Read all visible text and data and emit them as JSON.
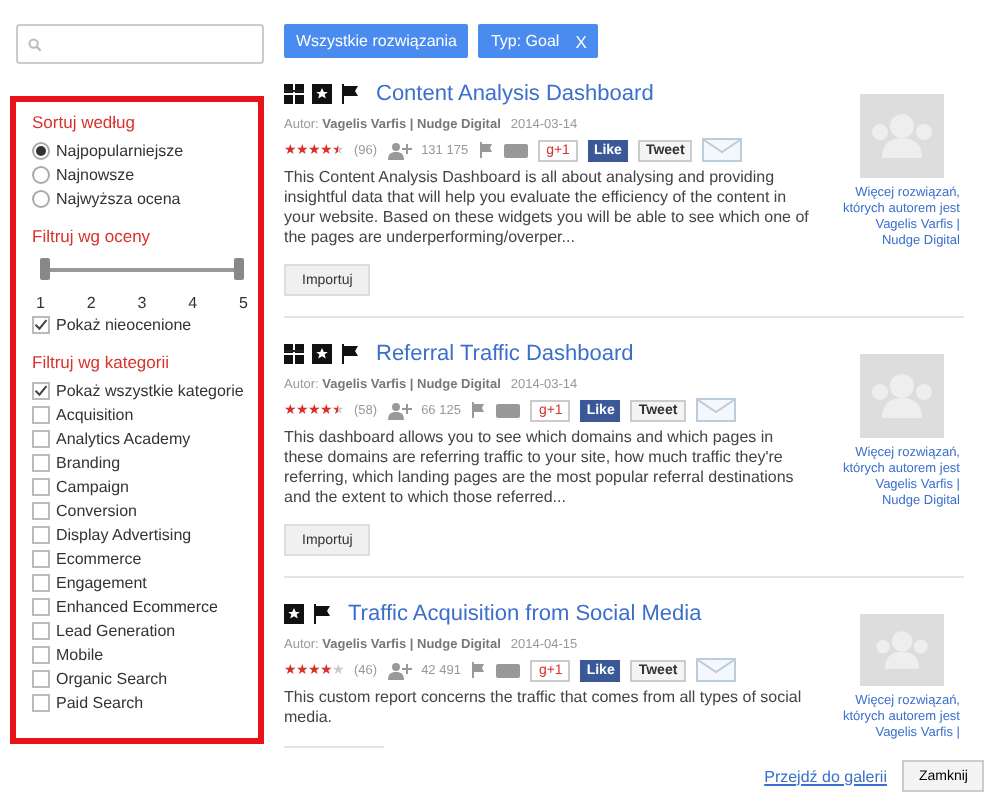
{
  "filters": [
    {
      "label": "Wszystkie rozwiązania"
    },
    {
      "label": "Typ: Goal",
      "remove": "X"
    }
  ],
  "sidebar": {
    "sort": {
      "title": "Sortuj według",
      "options": [
        {
          "label": "Najpopularniejsze",
          "selected": true
        },
        {
          "label": "Najnowsze",
          "selected": false
        },
        {
          "label": "Najwyższa ocena",
          "selected": false
        }
      ]
    },
    "rating": {
      "title": "Filtruj wg oceny",
      "handles": [
        {
          "level": 0
        },
        {
          "level": 1
        }
      ],
      "ticks": [
        "1",
        "2",
        "3",
        "4",
        "5"
      ],
      "unrated": {
        "label": "Pokaż nieocenione",
        "checked": true
      }
    },
    "categories": {
      "title": "Filtruj wg kategorii",
      "items": [
        {
          "label": "Pokaż wszystkie kategorie",
          "checked": true
        },
        {
          "label": "Acquisition",
          "checked": false
        },
        {
          "label": "Analytics Academy",
          "checked": false
        },
        {
          "label": "Branding",
          "checked": false
        },
        {
          "label": "Campaign",
          "checked": false
        },
        {
          "label": "Conversion",
          "checked": false
        },
        {
          "label": "Display Advertising",
          "checked": false
        },
        {
          "label": "Ecommerce",
          "checked": false
        },
        {
          "label": "Engagement",
          "checked": false
        },
        {
          "label": "Enhanced Ecommerce",
          "checked": false
        },
        {
          "label": "Lead Generation",
          "checked": false
        },
        {
          "label": "Mobile",
          "checked": false
        },
        {
          "label": "Organic Search",
          "checked": false
        },
        {
          "label": "Paid Search",
          "checked": false
        }
      ]
    }
  },
  "results": [
    {
      "icons": [
        {
          "kind": "dashboard"
        },
        {
          "kind": "segment"
        },
        {
          "kind": "goal"
        }
      ],
      "gplus": "g+1",
      "like": "Like",
      "tweet": "Tweet",
      "title": "Content Analysis Dashboard",
      "author_label": "Autor:",
      "author": "Vagelis Varfis | Nudge Digital",
      "date": "2014-03-14",
      "stars": 4.5,
      "reviews": "(96)",
      "imports": "131 175",
      "description": "This Content Analysis Dashboard is all about analysing and providing insightful data that will help you evaluate the efficiency of the content in your website. Based on these widgets you will be able to see which one of the pages are underperforming/overper...",
      "import_button": "Importuj",
      "more_link": [
        "Więcej rozwiązań,",
        "których autorem jest",
        "Vagelis Varfis |",
        "Nudge Digital"
      ]
    },
    {
      "icons": [
        {
          "kind": "dashboard"
        },
        {
          "kind": "segment"
        },
        {
          "kind": "goal"
        }
      ],
      "gplus": "g+1",
      "like": "Like",
      "tweet": "Tweet",
      "title": "Referral Traffic Dashboard",
      "author_label": "Autor:",
      "author": "Vagelis Varfis | Nudge Digital",
      "date": "2014-03-14",
      "stars": 4.5,
      "reviews": "(58)",
      "imports": "66 125",
      "description": "This dashboard allows you to see which domains and which pages in these domains are referring traffic to your site, how much traffic they're referring, which landing pages are the most popular referral destinations and the extent to which those referred...",
      "import_button": "Importuj",
      "more_link": [
        "Więcej rozwiązań,",
        "których autorem jest",
        "Vagelis Varfis |",
        "Nudge Digital"
      ]
    },
    {
      "icons": [
        {
          "kind": "segment"
        },
        {
          "kind": "goal"
        }
      ],
      "gplus": "g+1",
      "like": "Like",
      "tweet": "Tweet",
      "title": "Traffic Acquisition from Social Media",
      "author_label": "Autor:",
      "author": "Vagelis Varfis | Nudge Digital",
      "date": "2014-04-15",
      "stars": 4,
      "reviews": "(46)",
      "imports": "42 491",
      "description": "This custom report concerns the traffic that comes from all types of social media.",
      "more_link": [
        "Więcej rozwiązań,",
        "których autorem jest",
        "Vagelis Varfis |"
      ]
    }
  ],
  "footer": {
    "gallery_link": "Przejdź do galerii",
    "close_button": "Zamknij"
  }
}
